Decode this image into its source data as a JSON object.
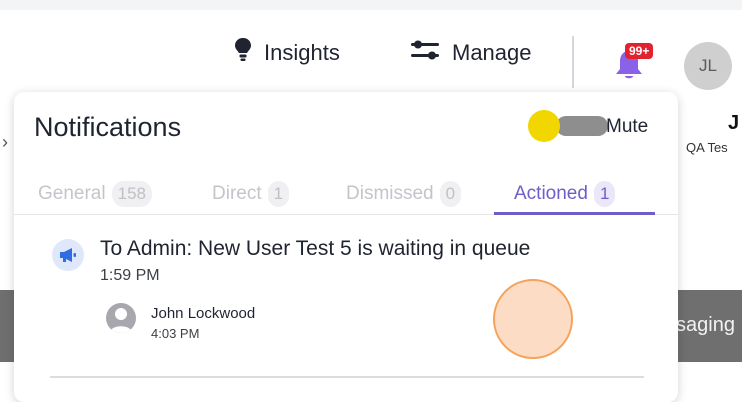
{
  "header": {
    "insights_label": "Insights",
    "manage_label": "Manage",
    "notification_badge": "99+",
    "avatar_initials": "JL"
  },
  "background": {
    "right_title": "J",
    "right_subtitle": "QA Tes",
    "right_message": "saging"
  },
  "notifications": {
    "title": "Notifications",
    "mute_label": "Mute",
    "tabs": [
      {
        "label": "General",
        "count": "158"
      },
      {
        "label": "Direct",
        "count": "1"
      },
      {
        "label": "Dismissed",
        "count": "0"
      },
      {
        "label": "Actioned",
        "count": "1"
      }
    ],
    "items": [
      {
        "title": "To Admin: New User Test 5 is waiting in queue",
        "time": "1:59 PM",
        "user_name": "John Lockwood",
        "user_time": "4:03 PM"
      }
    ]
  },
  "colors": {
    "accent": "#6d5fc7",
    "bell": "#8a62e8",
    "badge": "#e0242f",
    "toggle_knob": "#f1d600",
    "marker_fill": "#fddcc5",
    "marker_border": "#f5a25b"
  },
  "icons": {
    "insights": "lightbulb-icon",
    "manage": "sliders-icon",
    "bell": "bell-icon",
    "notification_type": "megaphone-icon",
    "user": "user-avatar-icon"
  }
}
